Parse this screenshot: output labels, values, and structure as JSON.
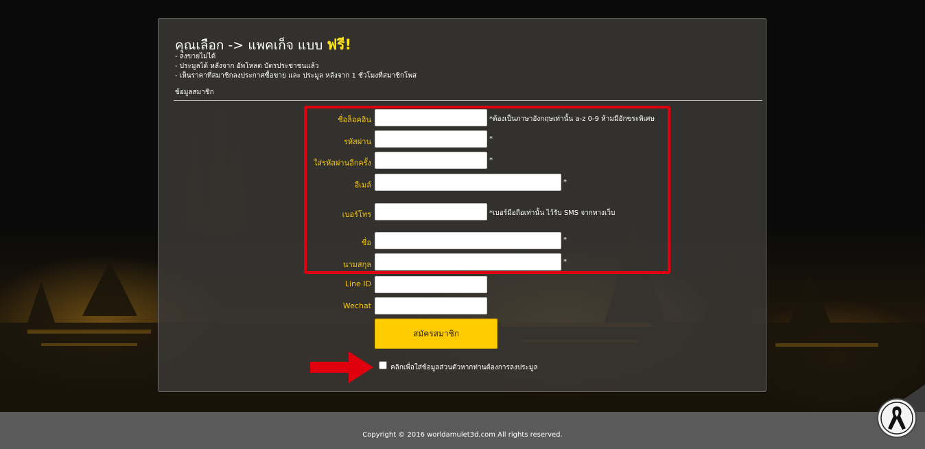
{
  "header": {
    "title_prefix": "คุณเลือก -> แพคเก็จ แบบ",
    "title_highlight": "ฟรี!"
  },
  "notes": [
    "- ลงขายไม่ได้",
    "- ประมูลได้ หลังจาก อัพโหลด บัตรประชาชนแล้ว",
    "- เห็นราคาที่สมาชิกลงประกาศซื้อขาย และ ประมูล หลังจาก 1 ชั่วโมงที่สมาชิกโพส"
  ],
  "section_label": "ข้อมูลสมาชิก",
  "form": {
    "username": {
      "label": "ชื่อล็อคอิน",
      "value": "",
      "hint": "*ต้องเป็นภาษาอังกฤษเท่านั้น a-z 0-9 ห้ามมีอักขระพิเศษ"
    },
    "password": {
      "label": "รหัสผ่าน",
      "value": "",
      "hint": "*"
    },
    "password_confirm": {
      "label": "ใส่รหัสผ่านอีกครั้ง",
      "value": "",
      "hint": "*"
    },
    "email": {
      "label": "อีเมล์",
      "value": "",
      "hint": "*"
    },
    "phone": {
      "label": "เบอร์โทร",
      "value": "",
      "hint": "*เบอร์มือถือเท่านั้น ไว้รับ SMS จากทางเว็บ"
    },
    "first_name": {
      "label": "ชื่อ",
      "value": "",
      "hint": "*"
    },
    "last_name": {
      "label": "นามสกุล",
      "value": "",
      "hint": "*"
    },
    "line_id": {
      "label": "Line ID",
      "value": ""
    },
    "wechat": {
      "label": "Wechat",
      "value": ""
    },
    "submit_label": "สมัครสมาชิก",
    "checkbox_label": "คลิกเพื่อใส่ข้อมูลส่วนตัวหากท่านต้องการลงประมูล",
    "checkbox_checked": false
  },
  "footer": {
    "copyright": "Copyright © 2016 worldamulet3d.com All rights reserved."
  },
  "colors": {
    "accent": "#ffcc00",
    "label": "#f4c60f",
    "highlight_box": "#e0000d",
    "footer_bg": "#5a5a5a"
  },
  "icons": {
    "ribbon": "mourning-ribbon-icon",
    "arrow": "red-arrow-right-icon"
  }
}
